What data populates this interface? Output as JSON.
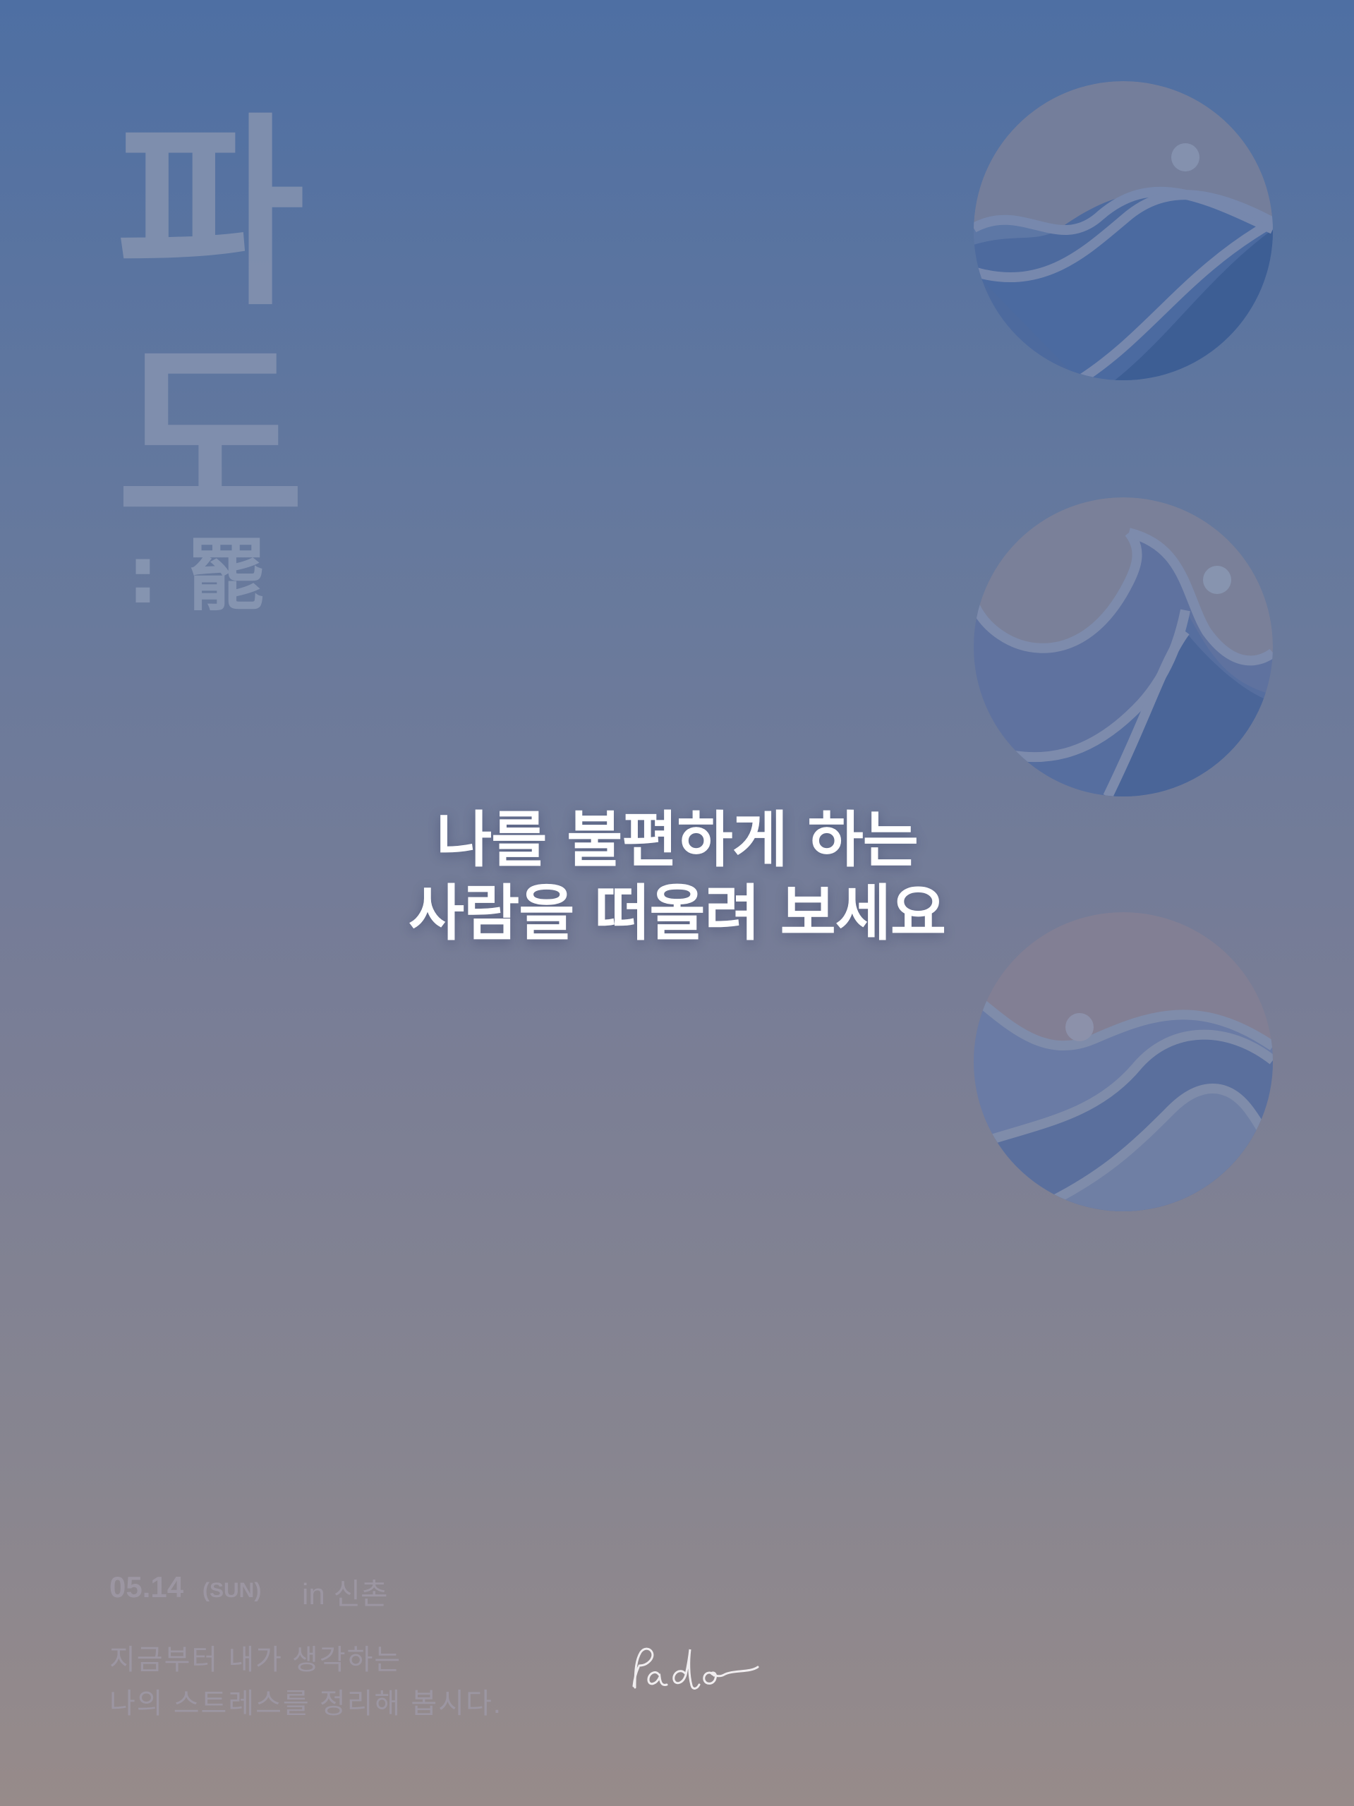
{
  "poster": {
    "title_vertical": [
      "파",
      "도"
    ],
    "subtitle": ":罷",
    "message": {
      "line1": "나를 불편하게 하는",
      "line2": "사람을 떠올려 보세요"
    },
    "event": {
      "date": "05.14",
      "day": "(SUN)",
      "place": "in 신촌"
    },
    "description": {
      "line1": "지금부터 내가 생각하는",
      "line2": "나의 스트레스를 정리해 봅시다."
    },
    "logo_text": "Pado",
    "icons": [
      "wave-circle-icon",
      "wave-circle-icon",
      "wave-circle-icon",
      "pado-signature-logo"
    ],
    "colors": {
      "background_top": "#4e6fa3",
      "background_bottom": "#978b8a",
      "title": "#8190ae",
      "message": "#ffffff",
      "footer": "#9c96a2",
      "wave_light": "#6a7bab",
      "wave_dark": "#3f5f95"
    }
  }
}
